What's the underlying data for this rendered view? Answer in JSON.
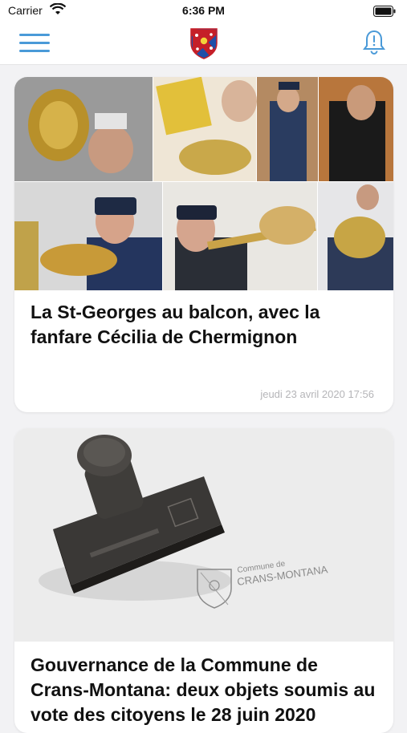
{
  "status_bar": {
    "carrier": "Carrier",
    "time": "6:36 PM"
  },
  "nav": {
    "menu_icon": "hamburger-menu-icon",
    "logo_icon": "crans-montana-crest-icon",
    "bell_icon": "notification-bell-icon",
    "accent_color": "#4a9ad8"
  },
  "feed": [
    {
      "title": "La St-Georges au balcon, avec la fanfare Cécilia de Chermignon",
      "date": "jeudi 23 avril 2020 17:56"
    },
    {
      "title": "Gouvernance de la Commune de Crans-Montana: deux objets soumis au vote des citoyens le 28 juin 2020",
      "image_text": {
        "line1": "Commune de",
        "line2": "CRANS-MONTANA"
      }
    }
  ]
}
